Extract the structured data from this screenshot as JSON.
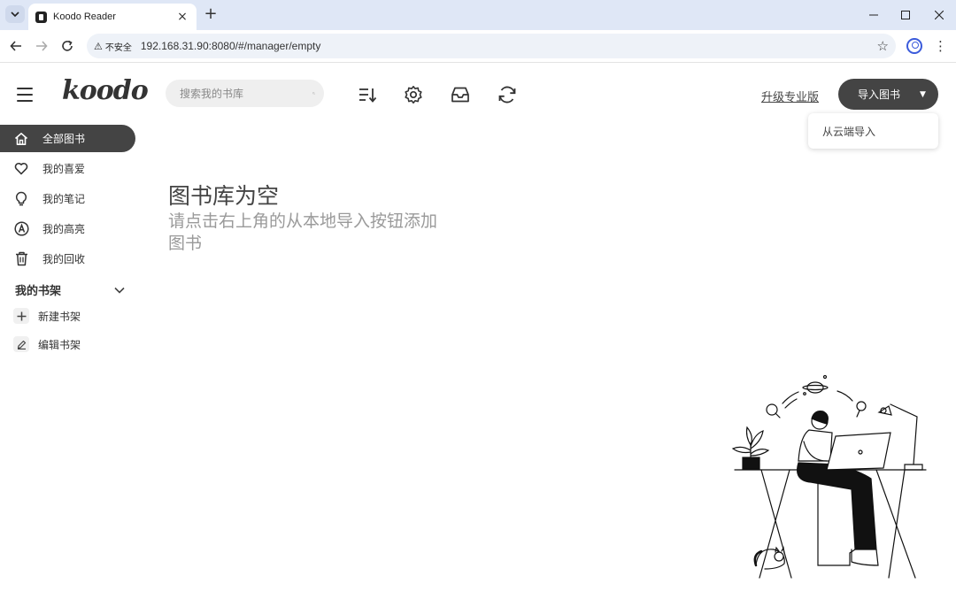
{
  "browser": {
    "tab_title": "Koodo Reader",
    "security_label": "不安全",
    "url": "192.168.31.90:8080/#/manager/empty",
    "tab_list_icon": "chevron-down-icon",
    "close_icon": "×",
    "new_tab_icon": "+",
    "minimize_glyph": "─",
    "maximize_glyph": "☐",
    "close_glyph": "✕",
    "back_glyph": "←",
    "forward_glyph": "→",
    "reload_glyph": "↻",
    "star_glyph": "☆",
    "menu_glyph": "⋮"
  },
  "header": {
    "logo": "koodo",
    "search_placeholder": "搜索我的书库",
    "upgrade_label": "升级专业版",
    "import_label": "导入图书",
    "import_caret": "▼",
    "dropdown_items": [
      "从云端导入"
    ]
  },
  "sidebar": {
    "items": [
      {
        "label": "全部图书",
        "icon": "home-icon",
        "active": true
      },
      {
        "label": "我的喜爱",
        "icon": "heart-icon",
        "active": false
      },
      {
        "label": "我的笔记",
        "icon": "lightbulb-icon",
        "active": false
      },
      {
        "label": "我的高亮",
        "icon": "highlight-icon",
        "active": false
      },
      {
        "label": "我的回收",
        "icon": "trash-icon",
        "active": false
      }
    ],
    "shelf_title": "我的书架",
    "shelf_actions": [
      {
        "label": "新建书架",
        "icon": "plus-icon"
      },
      {
        "label": "编辑书架",
        "icon": "edit-icon"
      }
    ]
  },
  "main": {
    "empty_title": "图书库为空",
    "empty_description": "请点击右上角的从本地导入按钮添加图书"
  },
  "colors": {
    "accent": "#444444",
    "tabbar": "#dfe7f6",
    "omnibox": "#eef2f8"
  }
}
